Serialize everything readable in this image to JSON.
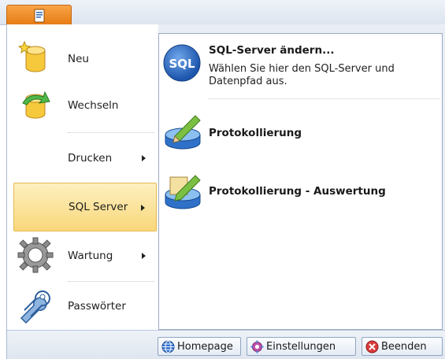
{
  "left_menu": {
    "items": [
      {
        "label": "Neu",
        "icon": "new-database-icon",
        "has_submenu": false
      },
      {
        "label": "Wechseln",
        "icon": "switch-database-icon",
        "has_submenu": false
      },
      {
        "label": "Drucken",
        "icon": "",
        "has_submenu": true
      },
      {
        "label": "SQL Server",
        "icon": "",
        "has_submenu": true,
        "selected": true
      },
      {
        "label": "Wartung",
        "icon": "gear-icon",
        "has_submenu": true
      },
      {
        "label": "Passwörter",
        "icon": "keys-icon",
        "has_submenu": false
      }
    ]
  },
  "submenu": {
    "items": [
      {
        "title": "SQL-Server ändern...",
        "description": "Wählen Sie hier den SQL-Server und Datenpfad aus.",
        "icon": "sql-icon"
      },
      {
        "title": "Protokollierung",
        "description": "",
        "icon": "database-pencil-icon"
      },
      {
        "title": "Protokollierung - Auswertung",
        "description": "",
        "icon": "database-document-pencil-icon"
      }
    ]
  },
  "bottom_buttons": {
    "homepage": "Homepage",
    "settings": "Einstellungen",
    "exit": "Beenden"
  },
  "colors": {
    "app_button": "#e67a12",
    "selection": "#f9d77a",
    "frame": "#e9eef6"
  }
}
